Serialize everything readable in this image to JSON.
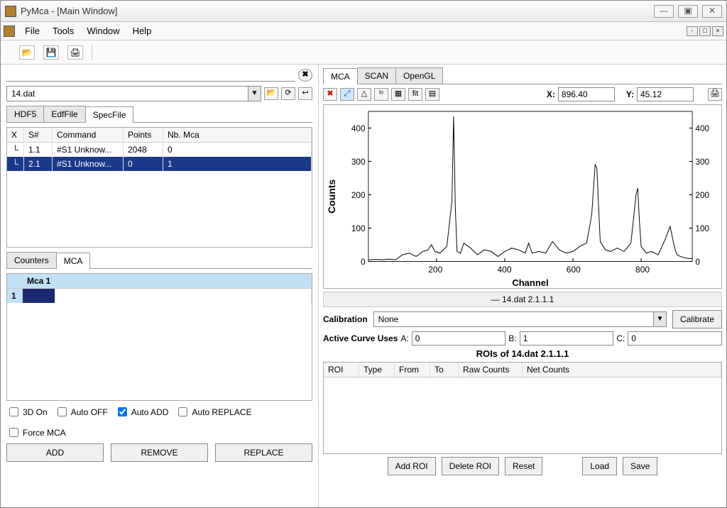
{
  "app": {
    "title": "PyMca - [Main Window]"
  },
  "menu": {
    "file": "File",
    "tools": "Tools",
    "window": "Window",
    "help": "Help"
  },
  "file_selector": {
    "label": "14.dat"
  },
  "source_tabs": [
    "HDF5",
    "EdfFile",
    "SpecFile"
  ],
  "source_active_tab": 2,
  "scan_table": {
    "cols": [
      "X",
      "S#",
      "Command",
      "Points",
      "Nb. Mca"
    ],
    "rows": [
      {
        "X": "",
        "S": "1.1",
        "Command": "#S1 Unknow...",
        "Points": "2048",
        "Nb": "0",
        "selected": false
      },
      {
        "X": "",
        "S": "2.1",
        "Command": "#S1 Unknow...",
        "Points": "0",
        "Nb": "1",
        "selected": true
      }
    ]
  },
  "bottom_tabs": {
    "items": [
      "Counters",
      "MCA"
    ],
    "active": 1
  },
  "mca_table": {
    "header": "Mca 1",
    "row1": "1"
  },
  "options": {
    "3d": "3D On",
    "autooff": "Auto OFF",
    "autoadd": "Auto ADD",
    "autoreplace": "Auto REPLACE",
    "forcemca": "Force MCA"
  },
  "left_buttons": {
    "add": "ADD",
    "remove": "REMOVE",
    "replace": "REPLACE"
  },
  "right_tabs": {
    "items": [
      "MCA",
      "SCAN",
      "OpenGL"
    ],
    "active": 0
  },
  "coords": {
    "xlabel": "X:",
    "xval": "896.40",
    "ylabel": "Y:",
    "yval": "45.12"
  },
  "chart_legend": "— 14.dat 2.1.1.1",
  "calibration": {
    "label": "Calibration",
    "value": "None",
    "btn": "Calibrate"
  },
  "active_curve": {
    "label": "Active Curve Uses",
    "alabel": "A:",
    "a": "0",
    "blabel": "B:",
    "b": "1",
    "clabel": "C:",
    "c": "0"
  },
  "roi_title": "ROIs of 14.dat 2.1.1.1",
  "roi_cols": [
    "ROI",
    "Type",
    "From",
    "To",
    "Raw Counts",
    "Net Counts"
  ],
  "roi_buttons": {
    "add": "Add ROI",
    "delete": "Delete ROI",
    "reset": "Reset",
    "load": "Load",
    "save": "Save"
  },
  "chart_data": {
    "type": "line",
    "title": "",
    "xlabel": "Channel",
    "ylabel": "Counts",
    "xlim": [
      0,
      950
    ],
    "ylim": [
      0,
      450
    ],
    "xticks": [
      200,
      400,
      600,
      800
    ],
    "yticks": [
      0,
      100,
      200,
      300,
      400
    ],
    "x": [
      0,
      20,
      40,
      60,
      80,
      100,
      120,
      140,
      160,
      175,
      185,
      195,
      210,
      230,
      245,
      250,
      255,
      260,
      270,
      280,
      300,
      320,
      340,
      360,
      380,
      400,
      420,
      440,
      460,
      470,
      480,
      500,
      520,
      540,
      560,
      580,
      600,
      620,
      640,
      655,
      665,
      670,
      675,
      680,
      695,
      710,
      730,
      750,
      770,
      785,
      790,
      795,
      800,
      815,
      830,
      850,
      870,
      885,
      895,
      900,
      905,
      915,
      930,
      950
    ],
    "y": [
      5,
      6,
      5,
      7,
      5,
      20,
      25,
      15,
      30,
      35,
      50,
      30,
      25,
      45,
      180,
      435,
      160,
      30,
      25,
      55,
      40,
      20,
      35,
      30,
      15,
      30,
      40,
      35,
      25,
      55,
      25,
      30,
      25,
      60,
      35,
      25,
      30,
      45,
      55,
      140,
      290,
      280,
      170,
      60,
      35,
      30,
      40,
      30,
      55,
      200,
      220,
      120,
      45,
      25,
      30,
      20,
      65,
      105,
      55,
      35,
      20,
      15,
      10,
      8
    ]
  }
}
